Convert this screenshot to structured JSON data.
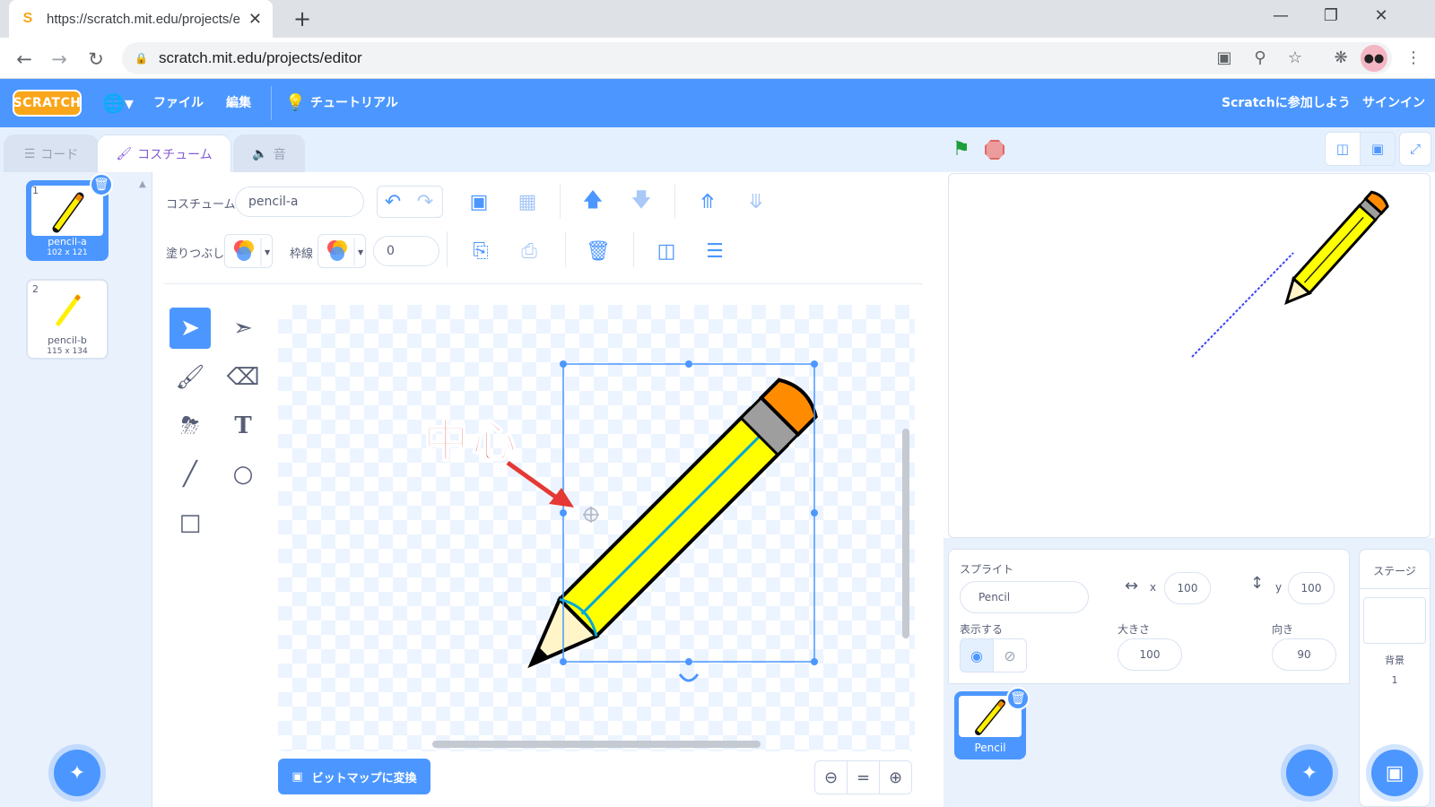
{
  "browser": {
    "tab_title": "https://scratch.mit.edu/projects/e",
    "tab_close": "✕",
    "new_tab": "+",
    "url": "scratch.mit.edu/projects/editor"
  },
  "menubar": {
    "logo": "SCRATCH",
    "file": "ファイル",
    "edit": "編集",
    "tutorials": "チュートリアル",
    "join": "Scratchに参加しよう",
    "signin": "サインイン"
  },
  "tabs": {
    "code": "コード",
    "costumes": "コスチューム",
    "sounds": "音"
  },
  "costumes": [
    {
      "num": "1",
      "name": "pencil-a",
      "size": "102 x 121"
    },
    {
      "num": "2",
      "name": "pencil-b",
      "size": "115 x 134"
    }
  ],
  "paint": {
    "costume_label": "コスチューム",
    "costume_name": "pencil-a",
    "fill_label": "塗りつぶし",
    "outline_label": "枠線",
    "outline_width": "0",
    "bitmap_button": "ビットマップに変換",
    "annotation": "中心"
  },
  "sprite": {
    "label": "スプライト",
    "name": "Pencil",
    "x_label": "x",
    "x": "100",
    "y_label": "y",
    "y": "100",
    "show_label": "表示する",
    "size_label": "大きさ",
    "size": "100",
    "direction_label": "向き",
    "direction": "90",
    "thumb_name": "Pencil"
  },
  "stage_panel": {
    "label": "ステージ",
    "backdrops_label": "背景",
    "backdrops_count": "1"
  },
  "colors": {
    "scratch_blue": "#4c97ff",
    "pencil_yellow": "#ffff00",
    "eraser_orange": "#ff8c00",
    "annotation_red": "#e53935"
  }
}
